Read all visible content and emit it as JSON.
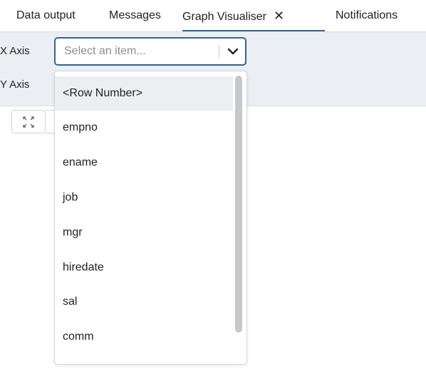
{
  "tabs": [
    {
      "label": "Data output"
    },
    {
      "label": "Messages"
    },
    {
      "label": "Graph Visualiser",
      "close": "✕"
    },
    {
      "label": "Notifications"
    }
  ],
  "toolbar": {
    "x_axis_label": "X Axis",
    "y_axis_label": "Y Axis",
    "x_select_placeholder": "Select an item..."
  },
  "dropdown": {
    "options": [
      "<Row Number>",
      "empno",
      "ename",
      "job",
      "mgr",
      "hiredate",
      "sal",
      "comm"
    ],
    "highlighted": "<Row Number>"
  },
  "colors": {
    "accent": "#326690",
    "toolbar_bg": "#ebeef3",
    "highlight_bg": "#eceef1"
  },
  "icons": {
    "expand": "expand-arrows-icon",
    "chevron": "chevron-down-icon"
  }
}
